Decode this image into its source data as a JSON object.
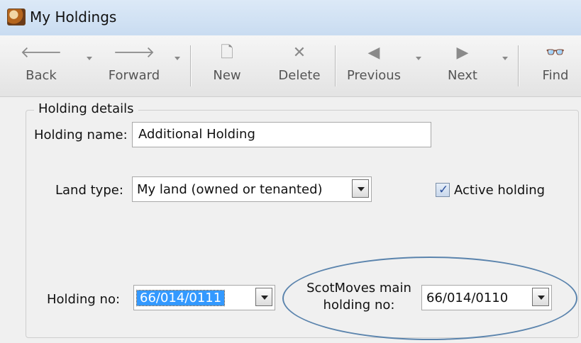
{
  "window": {
    "title": "My Holdings",
    "app_icon": "holding-app-icon"
  },
  "toolbar": {
    "back": {
      "label": "Back",
      "icon": "arrow-left-icon",
      "glyph": "🡐"
    },
    "forward": {
      "label": "Forward",
      "icon": "arrow-right-icon",
      "glyph": "🡒"
    },
    "new": {
      "label": "New",
      "icon": "new-document-icon",
      "glyph": "🗋"
    },
    "delete": {
      "label": "Delete",
      "icon": "delete-x-icon",
      "glyph": "✕"
    },
    "previous": {
      "label": "Previous",
      "icon": "triangle-left-icon",
      "glyph": "◀"
    },
    "next": {
      "label": "Next",
      "icon": "triangle-right-icon",
      "glyph": "▶"
    },
    "find": {
      "label": "Find",
      "icon": "binoculars-icon",
      "glyph": "👓"
    }
  },
  "form": {
    "group_title": "Holding details",
    "holding_name_label": "Holding name:",
    "holding_name_value": "Additional Holding",
    "land_type_label": "Land type:",
    "land_type_value": "My land (owned or tenanted)",
    "active_holding_label": "Active holding",
    "active_holding_checked": true,
    "holding_no_label": "Holding no:",
    "holding_no_value": "66/014/0111",
    "scotmoves_label_line1": "ScotMoves main",
    "scotmoves_label_line2": "holding no:",
    "scotmoves_value": "66/014/0110"
  },
  "colors": {
    "annotation_ellipse": "#5b84ad",
    "selection": "#3399ff"
  }
}
